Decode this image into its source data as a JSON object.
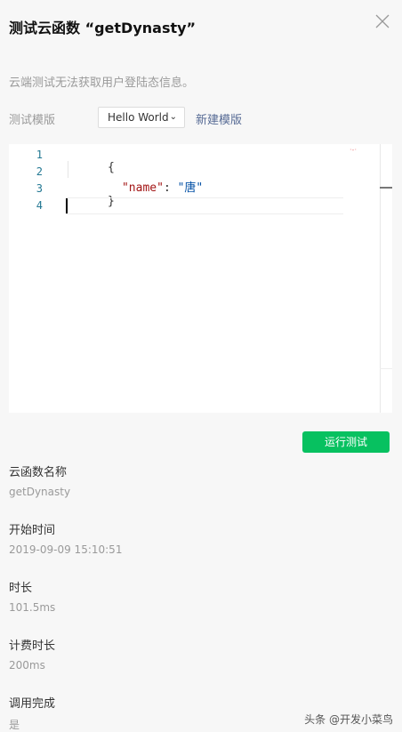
{
  "header": {
    "title": "测试云函数 “getDynasty”"
  },
  "notice": "云端测试无法获取用户登陆态信息。",
  "template": {
    "label": "测试模版",
    "selected": "Hello World",
    "new_label": "新建模版"
  },
  "editor": {
    "line_numbers": [
      "1",
      "2",
      "3",
      "4"
    ],
    "lines": {
      "l1": "{",
      "l2_key": "\"name\"",
      "l2_sep": ": ",
      "l2_val": "\"唐\"",
      "l3": "}"
    }
  },
  "run_button": "运行测试",
  "fields": [
    {
      "label": "云函数名称",
      "value": "getDynasty"
    },
    {
      "label": "开始时间",
      "value": "2019-09-09 15:10:51"
    },
    {
      "label": "时长",
      "value": "101.5ms"
    },
    {
      "label": "计费时长",
      "value": "200ms"
    },
    {
      "label": "调用完成",
      "value": "是"
    }
  ],
  "watermark": "头条 @开发小菜鸟",
  "colors": {
    "accent": "#07c160",
    "link": "#576b95"
  },
  "icons": {
    "close": "close-icon",
    "dropdown": "chevron-down-icon"
  }
}
